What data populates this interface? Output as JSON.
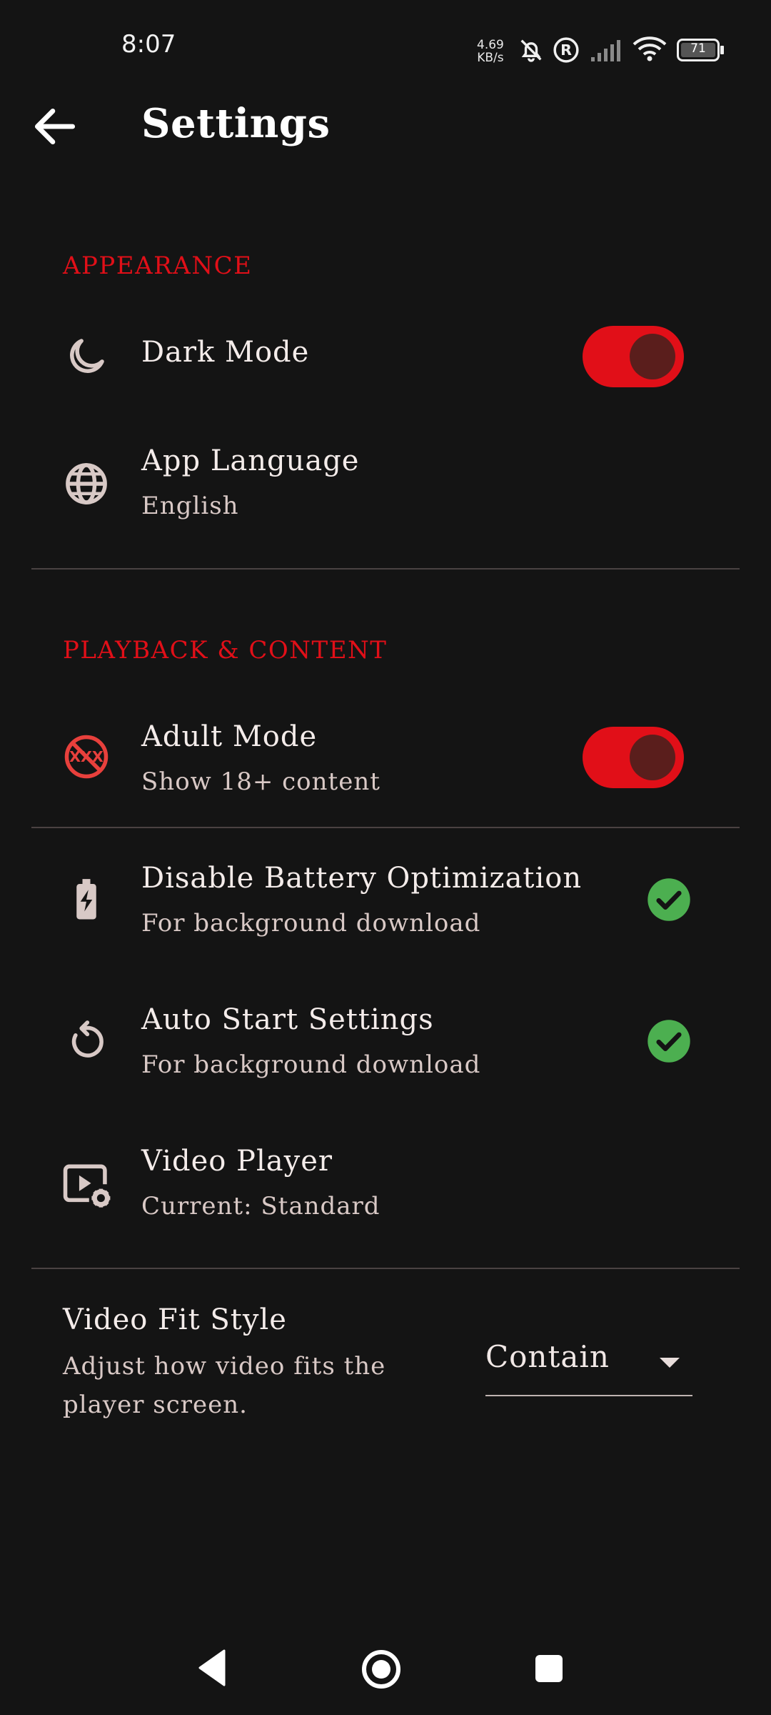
{
  "status_bar": {
    "time": "8:07",
    "net_speed_value": "4.69",
    "net_speed_unit": "KB/s",
    "battery": "71",
    "icons": [
      "bell-off-icon",
      "registered-icon",
      "signal-icon",
      "wifi-icon",
      "battery-icon"
    ]
  },
  "header": {
    "title": "Settings",
    "back_icon": "arrow-left-icon"
  },
  "appearance": {
    "section_label": "APPEARANCE",
    "dark_mode": {
      "label": "Dark Mode",
      "enabled": true,
      "icon": "moon-icon"
    },
    "app_language": {
      "label": "App Language",
      "value": "English",
      "icon": "globe-icon"
    }
  },
  "playback": {
    "section_label": "PLAYBACK & CONTENT",
    "adult_mode": {
      "label": "Adult Mode",
      "sub": "Show 18+ content",
      "enabled": true,
      "icon": "xxx-icon"
    },
    "battery_opt": {
      "label": "Disable Battery Optimization",
      "sub": "For background download",
      "status": "done",
      "icon": "battery-charging-icon"
    },
    "auto_start": {
      "label": "Auto Start Settings",
      "sub": "For background download",
      "status": "done",
      "icon": "refresh-icon"
    },
    "video_player": {
      "label": "Video Player",
      "sub": "Current: Standard",
      "icon": "video-settings-icon"
    },
    "video_fit": {
      "label": "Video Fit Style",
      "sub_line1": "Adjust how video fits the",
      "sub_line2": "player screen.",
      "selected": "Contain"
    }
  },
  "colors": {
    "accent": "#e10f18",
    "background": "#141414",
    "check": "#4caf50"
  },
  "nav_bar": {
    "icons": [
      "back-triangle-icon",
      "home-circle-icon",
      "recents-square-icon"
    ]
  }
}
